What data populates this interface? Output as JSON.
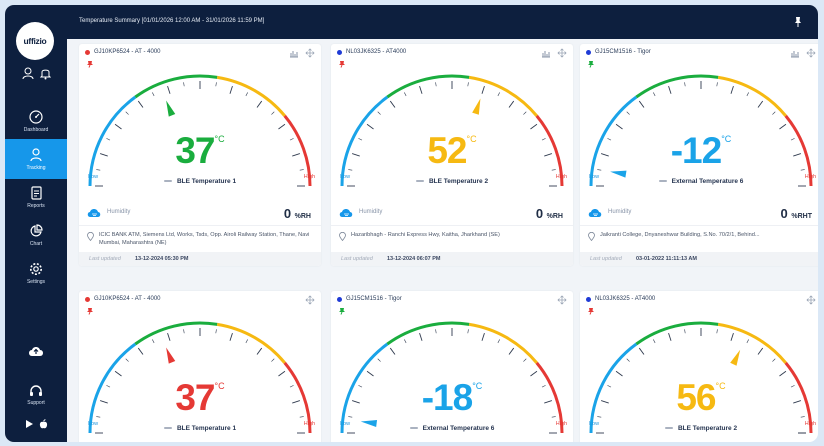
{
  "app": {
    "logo_text": "uffizio",
    "header_title": "Temperature Summary [01/01/2026 12:00 AM - 31/01/2026 11:59 PM]"
  },
  "sidebar": {
    "items": [
      {
        "label": "Dashboard",
        "icon": "speedometer-icon",
        "active": false
      },
      {
        "label": "Tracking",
        "icon": "location-person-icon",
        "active": true
      },
      {
        "label": "Reports",
        "icon": "report-doc-icon",
        "active": false
      },
      {
        "label": "Chart",
        "icon": "pie-chart-icon",
        "active": false
      },
      {
        "label": "Settings",
        "icon": "gear-icon",
        "active": false
      }
    ],
    "support_label": "Support"
  },
  "labels": {
    "low": "Low",
    "high": "High",
    "humidity": "Humidity",
    "last_updated": "Last updated"
  },
  "colors": {
    "ok_green": "#1aad3e",
    "warn_yellow": "#f6b912",
    "alert_red": "#e53935",
    "cold_blue": "#1aa3e8",
    "navy": "#0d1f3e",
    "accent": "#1697ea"
  },
  "cards": [
    {
      "vehicle": "GJ10KP6524 - AT - 4000",
      "status_color": "#e53935",
      "pin_color": "#e53935",
      "show_chart_icon": true,
      "value": "37",
      "unit": "°C",
      "value_color": "#1aad3e",
      "needle_color": "#1aad3e",
      "needle_fraction": 0.38,
      "sensor": "BLE Temperature 1",
      "humidity_value": "0",
      "humidity_unit": "%RH",
      "address": "ICIC BANK ATM, Siemens Ltd, Works, Tsds, Opp. Airoli Railway Station, Thane, Navi Mumbai, Maharashtra (NE)",
      "last_updated": "13-12-2024 05:30 PM"
    },
    {
      "vehicle": "NL03JK6325 - AT4000",
      "status_color": "#1f3bd6",
      "pin_color": "#e53935",
      "show_chart_icon": true,
      "value": "52",
      "unit": "°C",
      "value_color": "#f6b912",
      "needle_color": "#f6b912",
      "needle_fraction": 0.6,
      "sensor": "BLE Temperature 2",
      "humidity_value": "0",
      "humidity_unit": "%RH",
      "address": "Hazaribhagh - Ranchi Express Hwy, Kaitha, Jharkhand (SE)",
      "last_updated": "13-12-2024 06:07 PM"
    },
    {
      "vehicle": "GJ15CM1516 - Tigor",
      "status_color": "#1f3bd6",
      "pin_color": "#1aad3e",
      "show_chart_icon": true,
      "value": "-12",
      "unit": "°C",
      "value_color": "#1aa3e8",
      "needle_color": "#1aa3e8",
      "needle_fraction": 0.05,
      "sensor": "External Temperature 6",
      "humidity_value": "0",
      "humidity_unit": "%RHT",
      "address": "Jaikranti College, Dnyaneshwar Building, S.No. 70/2/1, Behind...",
      "last_updated": "03-01-2022 11:11:13 AM"
    },
    {
      "vehicle": "GJ10KP6524 - AT - 4000",
      "status_color": "#e53935",
      "pin_color": "#e53935",
      "show_chart_icon": false,
      "value": "37",
      "unit": "°C",
      "value_color": "#e53935",
      "needle_color": "#e53935",
      "needle_fraction": 0.38,
      "sensor": "BLE Temperature 1"
    },
    {
      "vehicle": "GJ15CM1516 - Tigor",
      "status_color": "#1f3bd6",
      "pin_color": "#1aad3e",
      "show_chart_icon": false,
      "value": "-18",
      "unit": "°C",
      "value_color": "#1aa3e8",
      "needle_color": "#1aa3e8",
      "needle_fraction": 0.04,
      "sensor": "External Temperature 6"
    },
    {
      "vehicle": "NL03JK6325 - AT4000",
      "status_color": "#1f3bd6",
      "pin_color": "#e53935",
      "show_chart_icon": false,
      "value": "56",
      "unit": "°C",
      "value_color": "#f6b912",
      "needle_color": "#f6b912",
      "needle_fraction": 0.64,
      "sensor": "BLE Temperature 2"
    }
  ]
}
